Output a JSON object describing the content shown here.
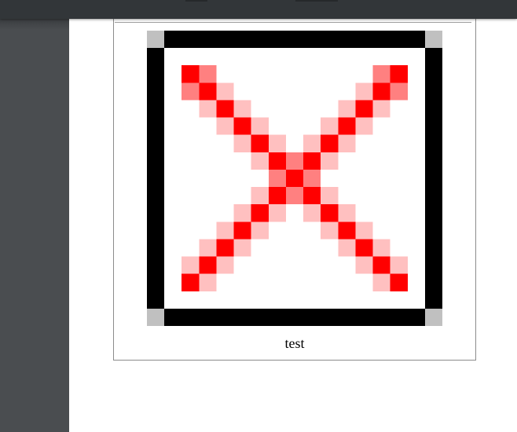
{
  "figure": {
    "caption": "test",
    "image_icon": "pixel-art-red-x-icon",
    "colors": {
      "frame": "#000000",
      "corner": "#c0c0c0",
      "red": "#ff0000",
      "mid_red": "#ff8080",
      "light_red": "#ffc0c0",
      "background": "#ffffff"
    }
  },
  "toolbar": {
    "tabs": [
      "tab",
      "tab"
    ]
  }
}
